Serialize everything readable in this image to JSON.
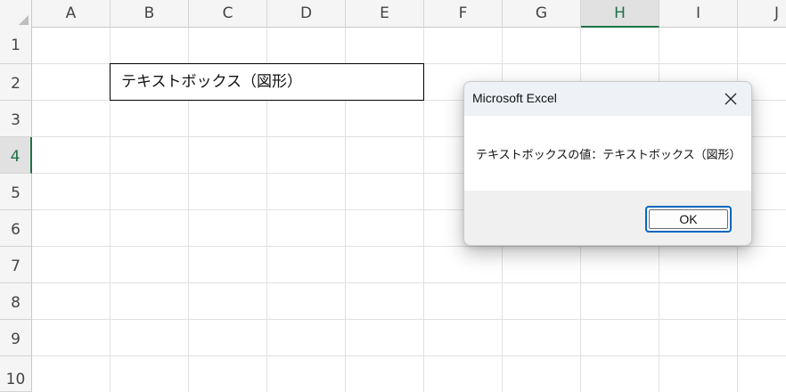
{
  "sheet": {
    "columns": [
      "A",
      "B",
      "C",
      "D",
      "E",
      "F",
      "G",
      "H",
      "I",
      "J"
    ],
    "rows": [
      "1",
      "2",
      "3",
      "4",
      "5",
      "6",
      "7",
      "8",
      "9",
      "10"
    ],
    "active_column": "H",
    "active_row": "4",
    "accent_color": "#1f7145"
  },
  "shape": {
    "text": "テキストボックス（図形）"
  },
  "dialog": {
    "title": "Microsoft Excel",
    "message": "テキストボックスの値：テキストボックス（図形）",
    "ok_label": "OK",
    "close_icon": "close-icon"
  }
}
